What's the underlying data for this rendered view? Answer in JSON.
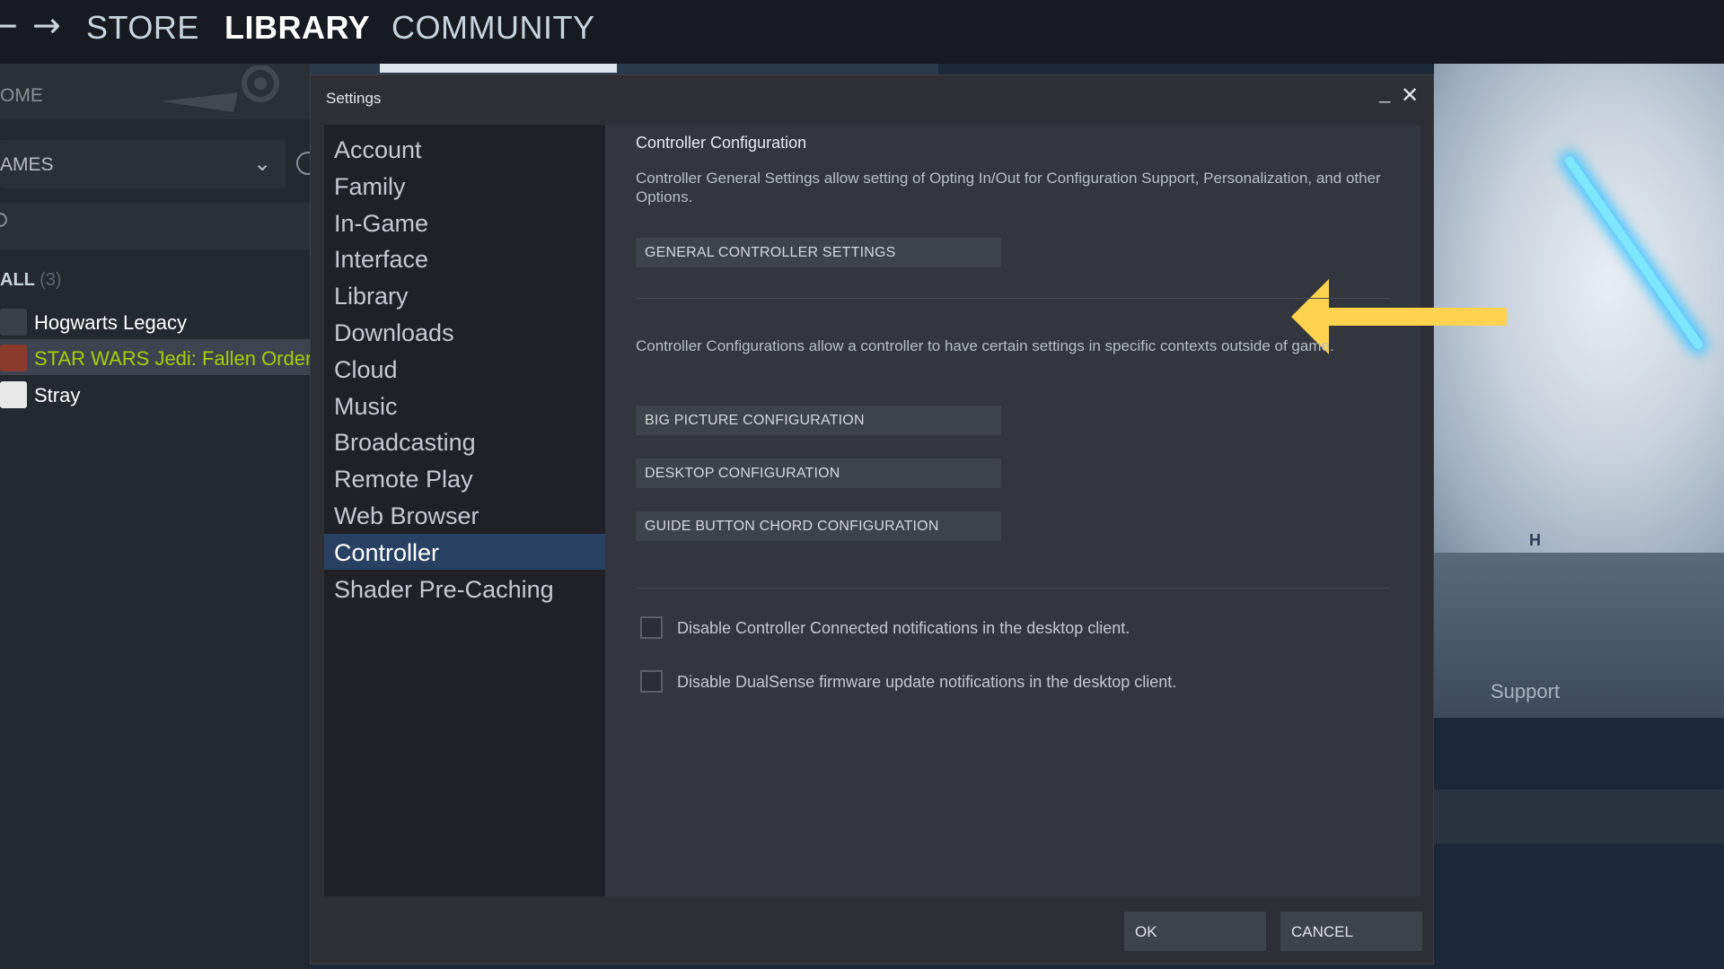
{
  "nav": {
    "back_glyph": "←",
    "forward_glyph": "→",
    "store": "STORE",
    "library": "LIBRARY",
    "community": "COMMUNITY"
  },
  "sidebar": {
    "home": "OME",
    "games": "AMES",
    "all_label": "ALL",
    "all_count": "(3)",
    "games_list": [
      {
        "name": "Hogwarts Legacy",
        "icon_color": "#3b3f47"
      },
      {
        "name": "STAR WARS Jedi: Fallen Order",
        "icon_color": "#8a3b2c",
        "selected": true
      },
      {
        "name": "Stray",
        "icon_color": "#e8e8e8"
      }
    ]
  },
  "hero": {
    "mark": "H",
    "support": "Support"
  },
  "dialog": {
    "title": "Settings",
    "minimize_glyph": "_",
    "close_glyph": "✕",
    "menu": [
      "Account",
      "Family",
      "In-Game",
      "Interface",
      "Library",
      "Downloads",
      "Cloud",
      "Music",
      "Broadcasting",
      "Remote Play",
      "Web Browser",
      "Controller",
      "Shader Pre-Caching"
    ],
    "active_menu": "Controller",
    "section_title": "Controller Configuration",
    "general_desc": "Controller General Settings allow setting of Opting In/Out for Configuration Support, Personalization, and other Options.",
    "general_button": "GENERAL CONTROLLER SETTINGS",
    "config_desc": "Controller Configurations allow a controller to have certain settings in specific contexts outside of game.",
    "big_picture_button": "BIG PICTURE CONFIGURATION",
    "desktop_button": "DESKTOP CONFIGURATION",
    "guide_button": "GUIDE BUTTON CHORD CONFIGURATION",
    "checkbox_connected": "Disable Controller Connected notifications in the desktop client.",
    "checkbox_dualsense": "Disable DualSense firmware update notifications in the desktop client.",
    "ok": "OK",
    "cancel": "CANCEL"
  },
  "colors": {
    "annotation_arrow": "#ffd34e",
    "menu_active": "#284163",
    "selected_game_text": "#a4d007"
  }
}
